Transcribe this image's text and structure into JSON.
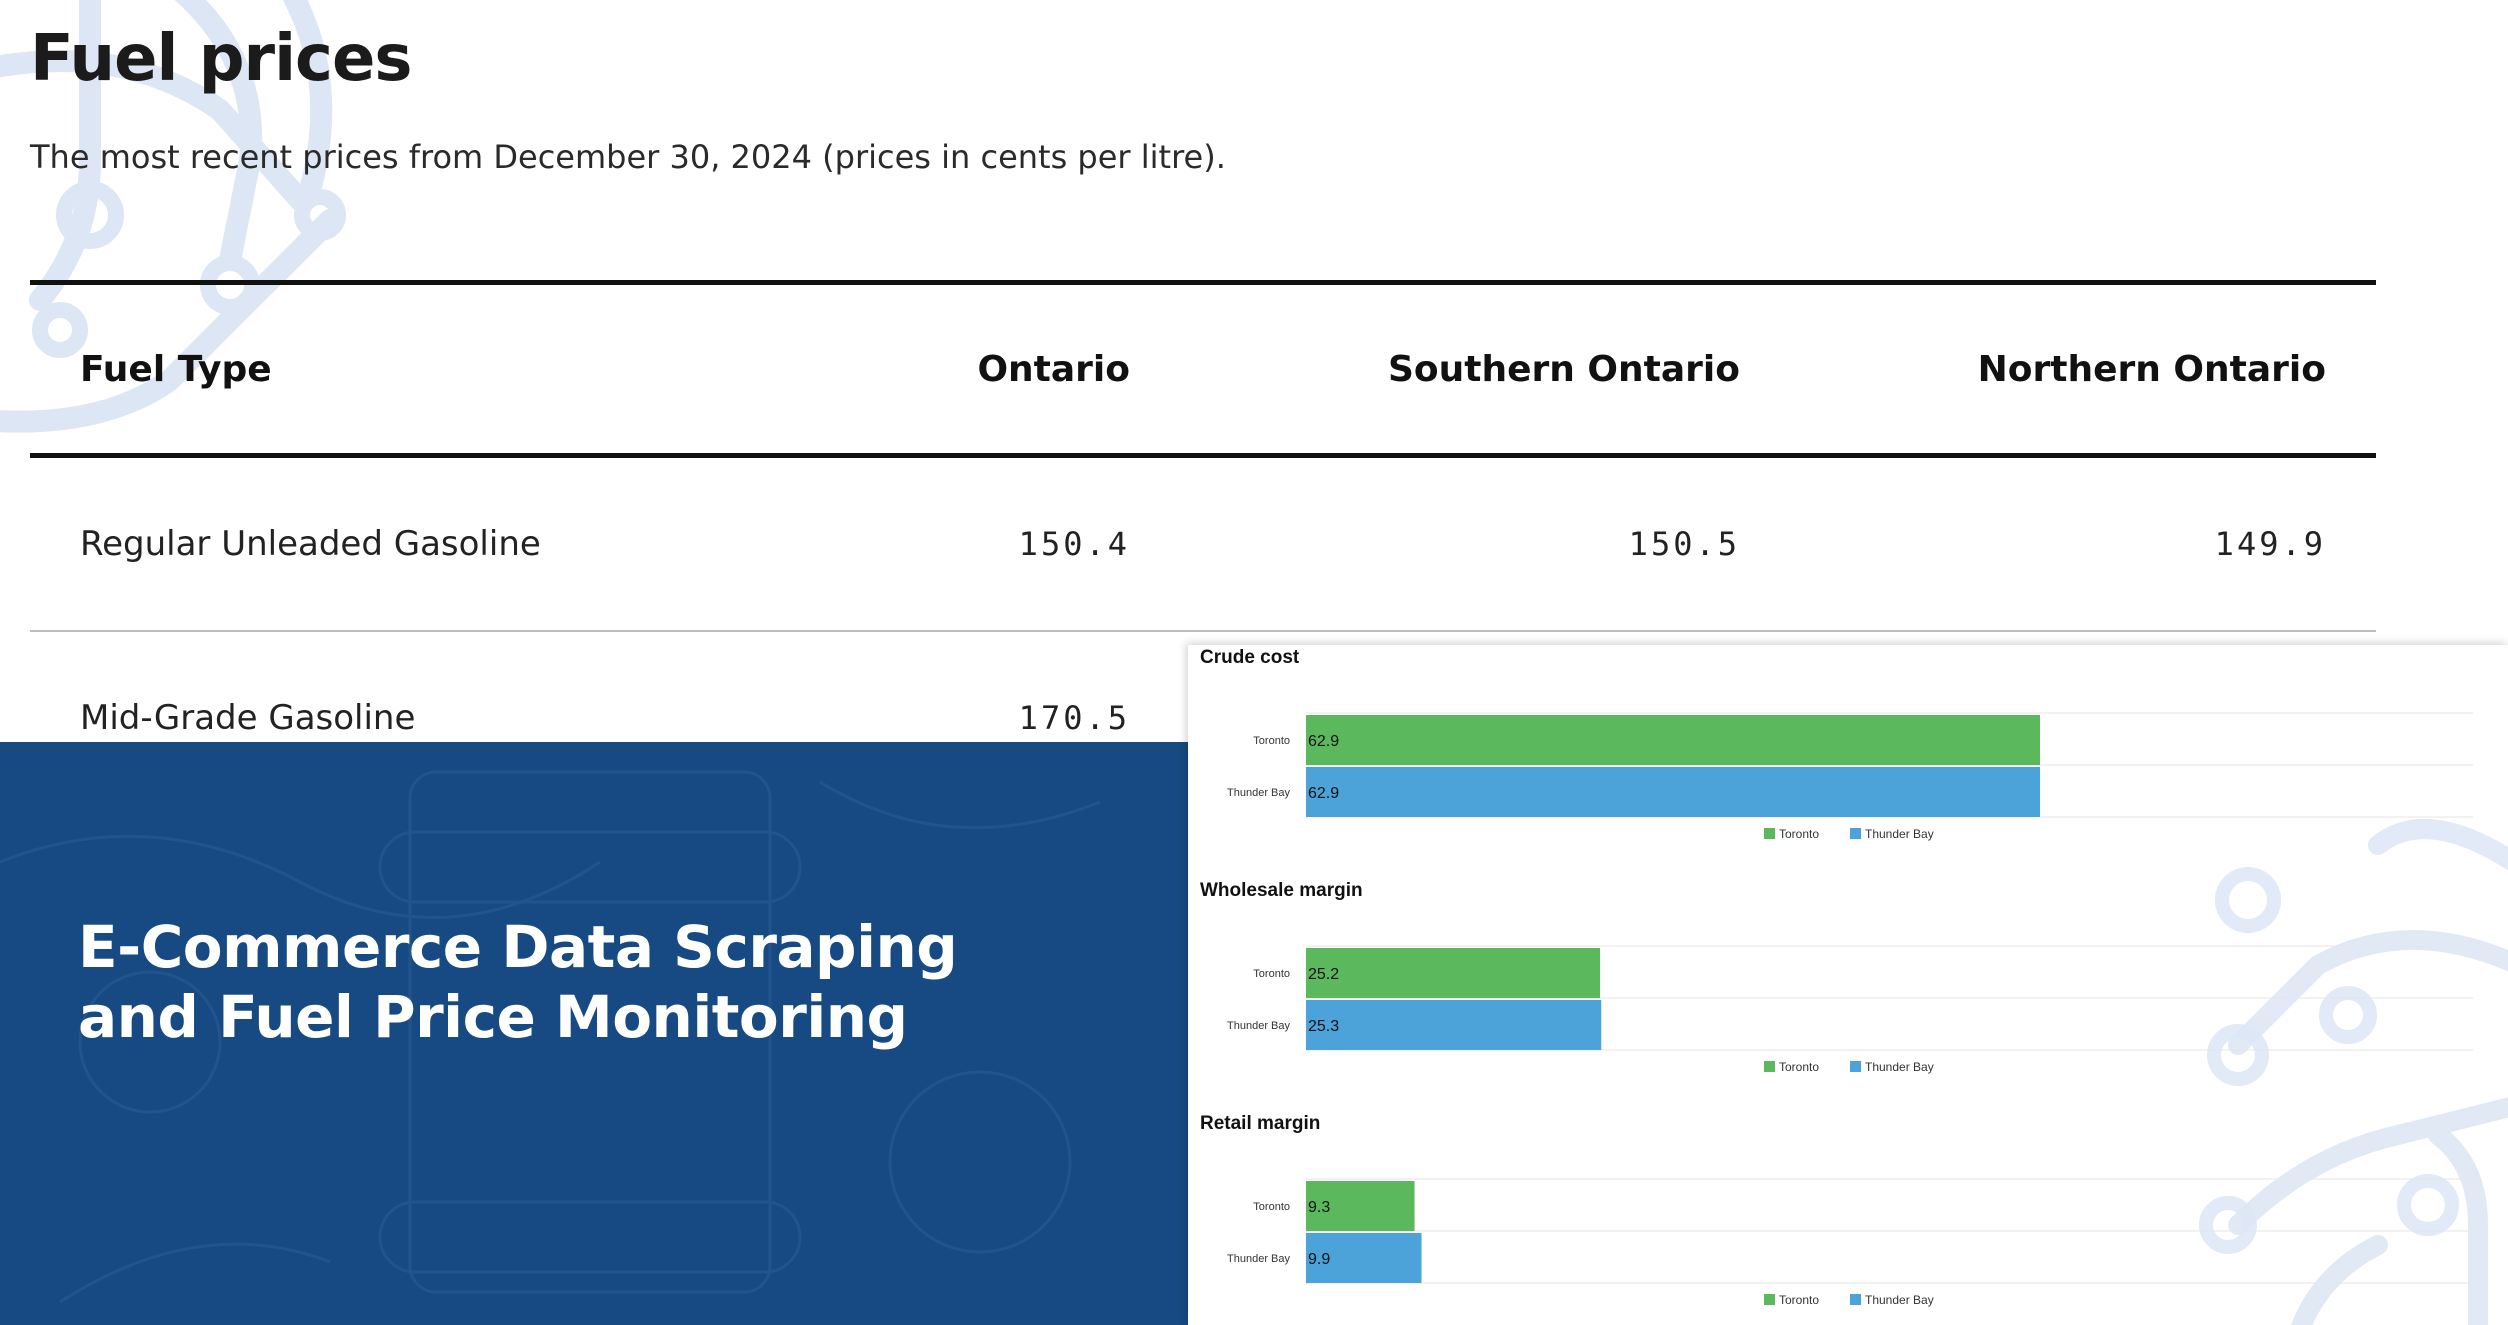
{
  "page": {
    "title": "Fuel prices",
    "subtitle": "The most recent prices from December 30, 2024 (prices in cents per litre)."
  },
  "table": {
    "headers": [
      "Fuel Type",
      "Ontario",
      "Southern Ontario",
      "Northern Ontario"
    ],
    "rows": [
      {
        "fuel": "Regular Unleaded Gasoline",
        "ontario": "150.4",
        "southern": "150.5",
        "northern": "149.9"
      },
      {
        "fuel": "Mid-Grade Gasoline",
        "ontario": "170.5",
        "southern": "",
        "northern": ""
      }
    ]
  },
  "promo": {
    "line1": "E-Commerce Data Scraping",
    "line2": "and Fuel Price Monitoring"
  },
  "colors": {
    "promo_background": "#174a82",
    "toronto": "#5cb85c",
    "thunder_bay": "#4ba3d9",
    "decor": "#dce6f4"
  },
  "chart_data": [
    {
      "type": "bar",
      "orientation": "horizontal",
      "title": "Crude cost",
      "categories": [
        "Toronto",
        "Thunder Bay"
      ],
      "values": [
        62.9,
        62.9
      ],
      "xlim": [
        0,
        100
      ],
      "grid": true,
      "legend": [
        "Toronto",
        "Thunder Bay"
      ],
      "legend_position": "bottom"
    },
    {
      "type": "bar",
      "orientation": "horizontal",
      "title": "Wholesale margin",
      "categories": [
        "Toronto",
        "Thunder Bay"
      ],
      "values": [
        25.2,
        25.3
      ],
      "xlim": [
        0,
        100
      ],
      "grid": true,
      "legend": [
        "Toronto",
        "Thunder Bay"
      ],
      "legend_position": "bottom"
    },
    {
      "type": "bar",
      "orientation": "horizontal",
      "title": "Retail margin",
      "categories": [
        "Toronto",
        "Thunder Bay"
      ],
      "values": [
        9.3,
        9.9
      ],
      "xlim": [
        0,
        100
      ],
      "grid": true,
      "legend": [
        "Toronto",
        "Thunder Bay"
      ],
      "legend_position": "bottom"
    }
  ]
}
